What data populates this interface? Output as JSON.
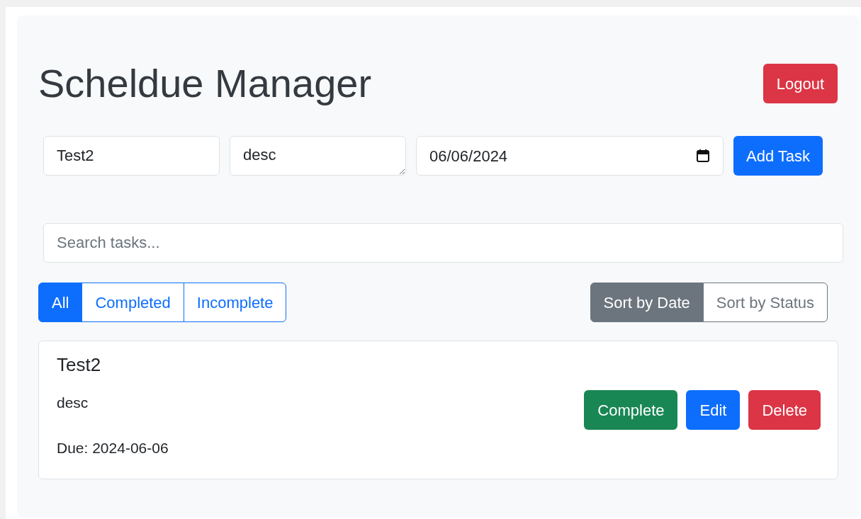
{
  "title": "Scheldue Manager",
  "logout": "Logout",
  "form": {
    "title_value": "Test2",
    "description_value": "desc",
    "date_value": "06/06/2024",
    "add_button": "Add Task"
  },
  "search": {
    "placeholder": "Search tasks..."
  },
  "filters": [
    {
      "label": "All",
      "selected": true
    },
    {
      "label": "Completed",
      "selected": false
    },
    {
      "label": "Incomplete",
      "selected": false
    }
  ],
  "sorts": [
    {
      "label": "Sort by Date",
      "selected": true
    },
    {
      "label": "Sort by Status",
      "selected": false
    }
  ],
  "tasks": [
    {
      "title": "Test2",
      "description": "desc",
      "due": "Due: 2024-06-06",
      "actions": [
        {
          "kind": "complete",
          "label": "Complete"
        },
        {
          "kind": "edit",
          "label": "Edit"
        },
        {
          "kind": "delete",
          "label": "Delete"
        }
      ]
    }
  ]
}
